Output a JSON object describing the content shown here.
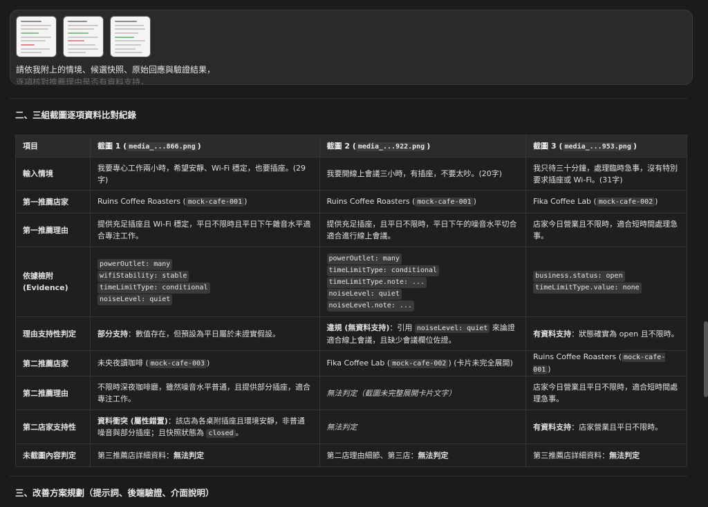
{
  "message": {
    "thumbnails": [
      "thumbnail-1",
      "thumbnail-2",
      "thumbnail-3"
    ],
    "text": "請依我附上的情境、候選快照、原始回應與驗證結果，",
    "text_faded": "逐項核對推薦理由是否有資料支持，"
  },
  "sections": {
    "s2_title": "二、三組截圖逐項資料比對紀錄",
    "s3_title": "三、改善方案規劃（提示詞、後端驗證、介面說明）"
  },
  "table": {
    "headers": {
      "item": "項目",
      "c1_prefix": "截圖 1 (",
      "c1_code": "media_...866.png",
      "c2_prefix": "截圖 2 (",
      "c2_code": "media_...922.png",
      "c3_prefix": "截圖 3 (",
      "c3_code": "media_...953.png",
      "suffix": ")"
    },
    "rows": {
      "input": {
        "label": "輸入情境",
        "c1": "我要專心工作兩小時，希望安靜、Wi-Fi 穩定，也要插座。(29字)",
        "c2": "我要開線上會議三小時，有插座，不要太吵。(20字)",
        "c3": "我只待三十分鐘，處理臨時急事，沒有特別要求插座或 Wi-Fi。(31字)"
      },
      "first_store": {
        "label": "第一推薦店家",
        "c1_name": "Ruins Coffee Roasters (",
        "c1_id": "mock-cafe-001",
        "c2_name": "Ruins Coffee Roasters (",
        "c2_id": "mock-cafe-001",
        "c3_name": "Fika Coffee Lab (",
        "c3_id": "mock-cafe-002",
        "close": ")"
      },
      "first_reason": {
        "label": "第一推薦理由",
        "c1": "提供充足插座且 Wi-Fi 穩定，平日不限時且平日下午雜音水平適合專注工作。",
        "c2": "提供充足插座，且平日不限時，平日下午的噪音水平切合適合進行線上會議。",
        "c3": "店家今日營業且不限時，適合短時間處理急事。"
      },
      "evidence": {
        "label": "依據檢附 (Evidence)",
        "c1": [
          "powerOutlet: many",
          "wifiStability: stable",
          "timeLimitType: conditional",
          "noiseLevel: quiet"
        ],
        "c2": [
          "powerOutlet: many",
          "timeLimitType: conditional",
          "timeLimitType.note: ...",
          "noiseLevel: quiet",
          "noiseLevel.note: ..."
        ],
        "c3": [
          "business.status: open",
          "timeLimitType.value: none"
        ]
      },
      "support": {
        "label": "理由支持性判定",
        "c1_bold": "部分支持",
        "c1_rest": "：數值存在，但預設為平日屬於未證實假設。",
        "c2_bold": "違規 (無資料支持)",
        "c2_pre": "：引用 ",
        "c2_code": "noiseLevel: quiet",
        "c2_post": " 來論證適合線上會議，且缺少會議欄位佐證。",
        "c3_bold": "有資料支持",
        "c3_rest": "：狀態確實為 open 且不限時。"
      },
      "second_store": {
        "label": "第二推薦店家",
        "c1_name": "未央夜讀咖啡 (",
        "c1_id": "mock-cafe-003",
        "c2_name": "Fika Coffee Lab (",
        "c2_id": "mock-cafe-002",
        "c2_tail": " (卡片未完全展開)",
        "c3_name": "Ruins Coffee Roasters (",
        "c3_id": "mock-cafe-001",
        "close": ")"
      },
      "second_reason": {
        "label": "第二推薦理由",
        "c1": "不限時深夜咖啡廳，雖然噪音水平普通，且提供部分插座，適合專注工作。",
        "c2": "無法判定（截圖未完整展開卡片文字）",
        "c3": "店家今日營業且平日不限時，適合短時間處理急事。"
      },
      "second_support": {
        "label": "第二店家支持性",
        "c1_bold": "資料衝突 (屬性錯置)",
        "c1_pre": "：該店為各桌附插座且環境安靜，非普通噪音與部分插座；且快照狀態為 ",
        "c1_code": "closed",
        "c1_post": "。",
        "c2": "無法判定",
        "c3_bold": "有資料支持",
        "c3_rest": "：店家營業且平日不限時。"
      },
      "uncaptured": {
        "label": "未截圖內容判定",
        "c1_pre": "第三推薦店詳細資料：",
        "c1_bold": "無法判定",
        "c2_pre": "第二店理由細節、第三店：",
        "c2_bold": "無法判定",
        "c3_pre": "第三推薦店詳細資料：",
        "c3_bold": "無法判定"
      }
    }
  }
}
